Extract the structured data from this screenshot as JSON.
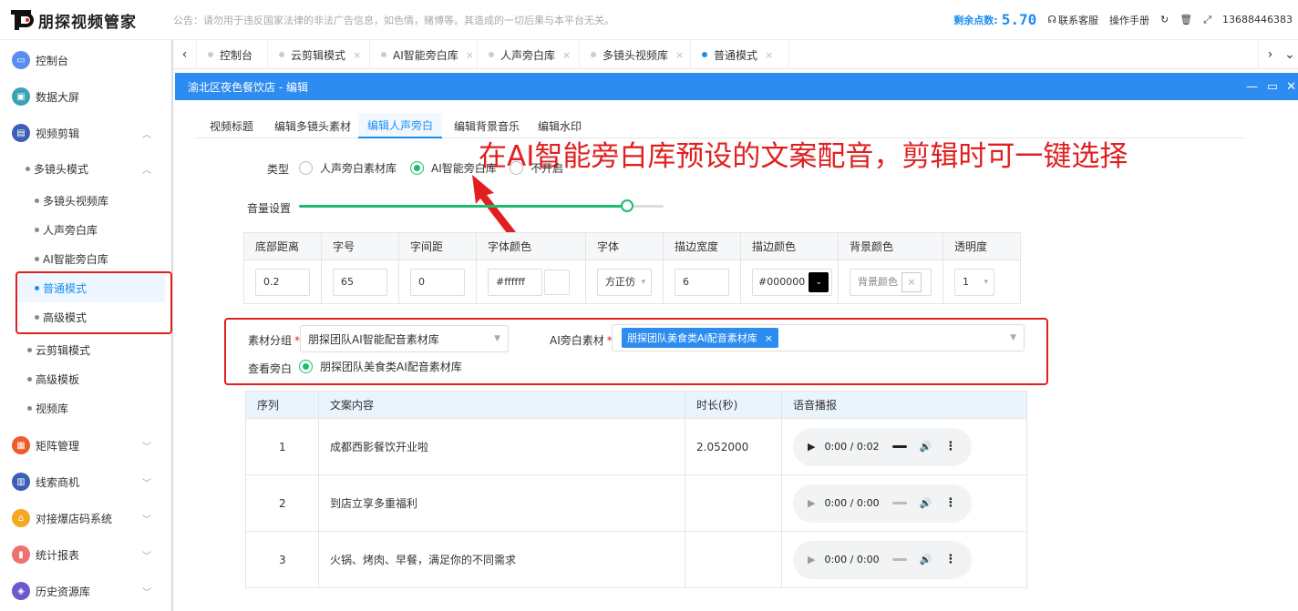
{
  "app": {
    "name": "朋探视频管家"
  },
  "notice": "公告：请勿用于违反国家法律的非法广告信息，如色情，赌博等。其造成的一切后果与本平台无关。",
  "header": {
    "points_label": "剩余点数:",
    "points_value": "5.70",
    "service": "联系客服",
    "manual": "操作手册",
    "phone": "13688446383",
    "icons": [
      "headset-icon",
      "refresh-icon",
      "trash-icon",
      "fullscreen-icon"
    ]
  },
  "sidebar": {
    "items": [
      {
        "label": "控制台",
        "color": "#5b8def"
      },
      {
        "label": "数据大屏",
        "color": "#3aa1b8"
      },
      {
        "label": "视频剪辑",
        "color": "#3b5fb6"
      },
      {
        "label": "矩阵管理",
        "color": "#f05a28"
      },
      {
        "label": "线索商机",
        "color": "#3b5fb6"
      },
      {
        "label": "对接爆店码系统",
        "color": "#f5a623"
      },
      {
        "label": "统计报表",
        "color": "#f07070"
      },
      {
        "label": "历史资源库",
        "color": "#6a5acd"
      }
    ],
    "sub": {
      "multi_mode": "多镜头模式",
      "multi_children": [
        "多镜头视频库",
        "人声旁白库",
        "AI智能旁白库",
        "普通模式",
        "高级模式"
      ],
      "cloud_mode": "云剪辑模式",
      "advanced_template": "高级模板",
      "video_lib": "视频库"
    }
  },
  "tabs": [
    "控制台",
    "云剪辑模式",
    "AI智能旁白库",
    "人声旁白库",
    "多镜头视频库",
    "普通模式"
  ],
  "modal": {
    "title": "渝北区夜色餐饮店 - 编辑",
    "subtabs": [
      "视频标题",
      "编辑多镜头素材",
      "编辑人声旁白",
      "编辑背景音乐",
      "编辑水印"
    ],
    "annotation": "在AI智能旁白库预设的文案配音，剪辑时可一键选择",
    "type_label": "类型",
    "type_options": [
      "人声旁白素材库",
      "AI智能旁白库",
      "不开启"
    ],
    "type_selected": 1,
    "volume_label": "音量设置",
    "volume": 0.9,
    "settings": {
      "headers": [
        "底部距离",
        "字号",
        "字间距",
        "字体颜色",
        "字体",
        "描边宽度",
        "描边颜色",
        "背景颜色",
        "透明度"
      ],
      "bottom": "0.2",
      "font_size": "65",
      "spacing": "0",
      "font_color": "#ffffff",
      "font": "方正仿",
      "stroke_width": "6",
      "stroke_color": "#000000",
      "bg_color_placeholder": "背景颜色",
      "opacity": "1"
    },
    "group_label": "素材分组",
    "group_value": "朋探团队AI智能配音素材库",
    "ai_label": "AI旁白素材",
    "ai_tag": "朋探团队美食类AI配音素材库",
    "view_label": "查看旁白",
    "view_option": "朋探团队美食类AI配音素材库",
    "list": {
      "headers": [
        "序列",
        "文案内容",
        "时长(秒)",
        "语音播报"
      ],
      "rows": [
        {
          "seq": "1",
          "text": "成都西影餐饮开业啦",
          "duration": "2.052000",
          "time": "0:00 / 0:02"
        },
        {
          "seq": "2",
          "text": "到店立享多重福利",
          "duration": "",
          "time": "0:00 / 0:00"
        },
        {
          "seq": "3",
          "text": "火锅、烤肉、早餐，满足你的不同需求",
          "duration": "",
          "time": "0:00 / 0:00"
        }
      ]
    }
  }
}
